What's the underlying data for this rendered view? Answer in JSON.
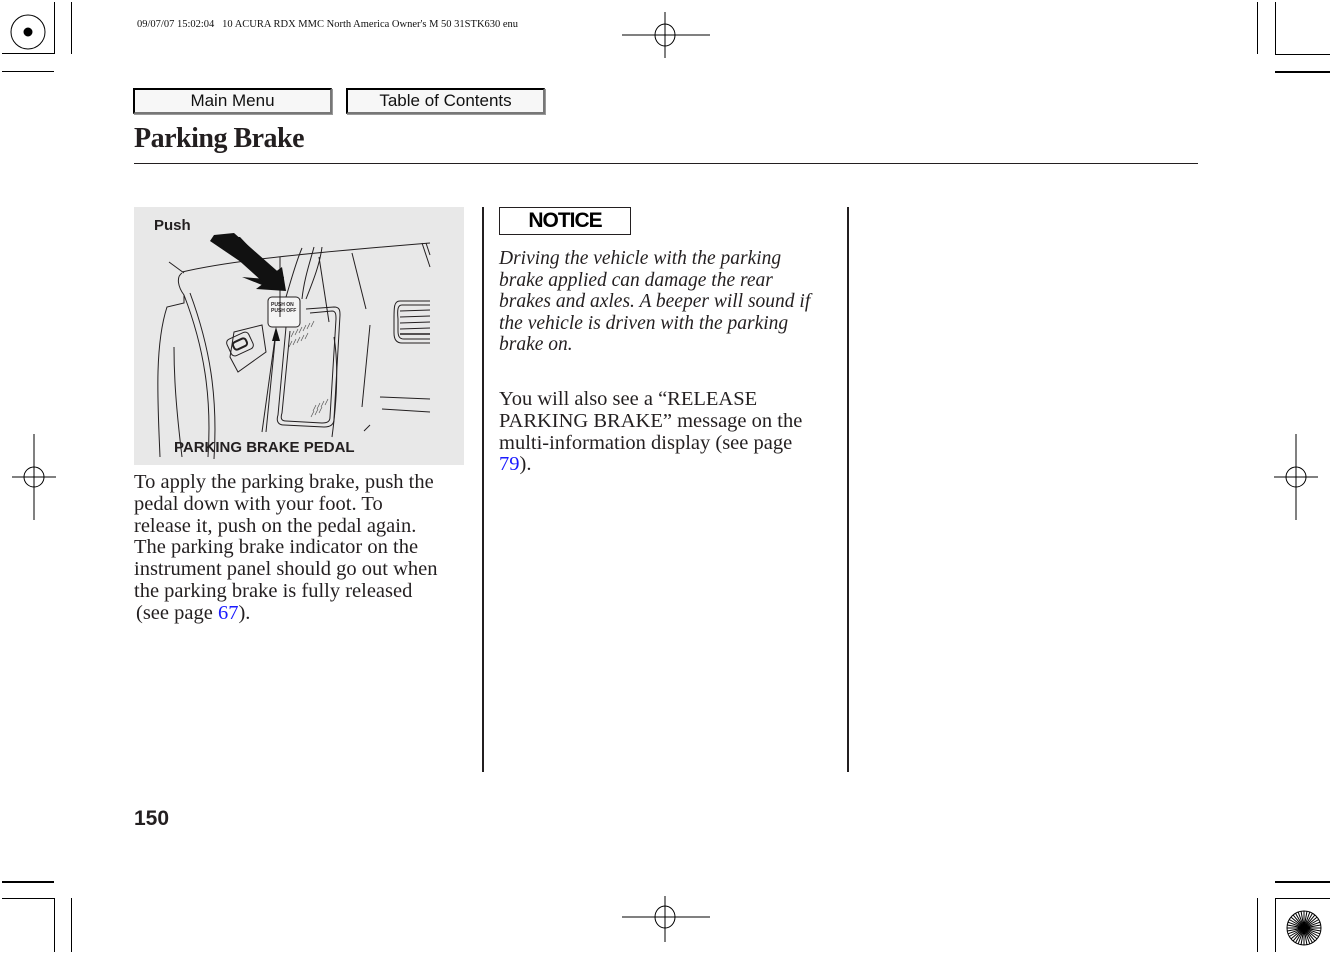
{
  "print_header": {
    "text": "09/07/07 15:02:04   10 ACURA RDX MMC North America Owner's M 50 31STK630 enu"
  },
  "nav": {
    "main_menu_label": "Main Menu",
    "toc_label": "Table of Contents"
  },
  "page": {
    "title": "Parking Brake",
    "number": "150"
  },
  "figure": {
    "push_label": "Push",
    "pedal_label": "PARKING BRAKE PEDAL",
    "pedal_text_line1": "PUSH ON",
    "pedal_text_line2": "PUSH OFF"
  },
  "left_column": {
    "paragraph_lines": [
      "To apply the parking brake, push the",
      "pedal down with your foot. To",
      "release it, push on the pedal again.",
      "The parking brake indicator on the",
      "instrument panel should go out when",
      "the parking brake is fully released"
    ],
    "ref_prefix": "(see page ",
    "ref_page": "67",
    "ref_suffix": ")."
  },
  "notice": {
    "label": "NOTICE",
    "lines": [
      "Driving the vehicle with the parking",
      "brake applied can damage the rear",
      "brakes and axles. A beeper will sound if",
      "the vehicle is driven with the parking",
      "brake on."
    ]
  },
  "middle_column": {
    "paragraph_lines": [
      "You will also see a “RELEASE",
      "PARKING BRAKE” message on the",
      "multi-information display (see page"
    ],
    "ref_page": "79",
    "ref_suffix": ")."
  },
  "colors": {
    "link": "#1a1aff",
    "text": "#231f20",
    "figure_bg": "#e8e8e8"
  }
}
